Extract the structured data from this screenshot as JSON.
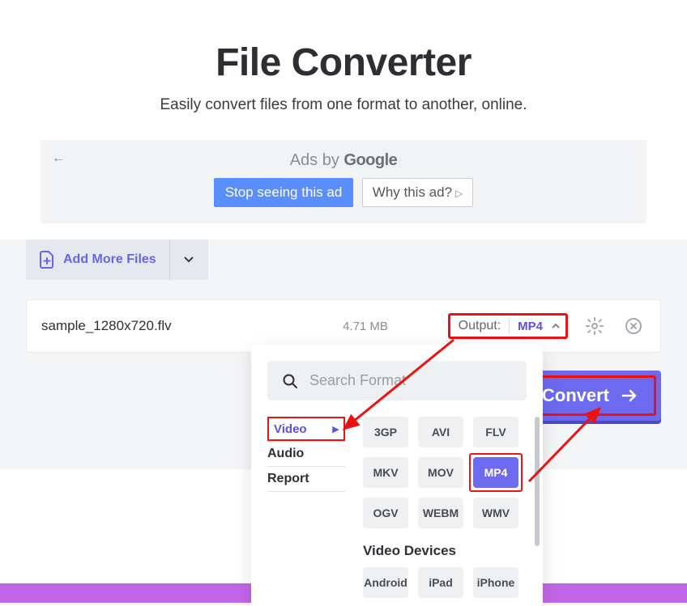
{
  "hero": {
    "title": "File Converter",
    "subtitle": "Easily convert files from one format to another, online."
  },
  "ad": {
    "by_prefix": "Ads by ",
    "brand": "Google",
    "stop": "Stop seeing this ad",
    "why": "Why this ad?"
  },
  "toolbar": {
    "add_more": "Add More Files"
  },
  "file": {
    "name": "sample_1280x720.flv",
    "size": "4.71 MB",
    "output_label": "Output:",
    "output_value": "MP4"
  },
  "convert_label": "Convert",
  "dropdown": {
    "search_placeholder": "Search Format",
    "categories": {
      "video": "Video",
      "audio": "Audio",
      "report": "Report"
    },
    "video_formats": [
      "3GP",
      "AVI",
      "FLV",
      "MKV",
      "MOV",
      "MP4",
      "OGV",
      "WEBM",
      "WMV"
    ],
    "selected_format": "MP4",
    "devices_heading": "Video Devices",
    "devices": [
      "Android",
      "iPad",
      "iPhone"
    ]
  }
}
